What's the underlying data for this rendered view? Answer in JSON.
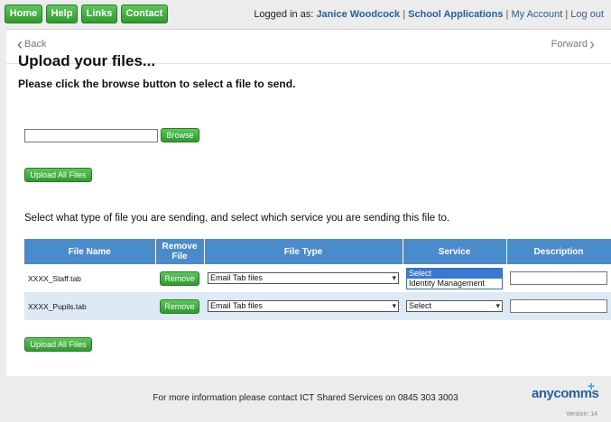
{
  "nav": {
    "home": "Home",
    "help": "Help",
    "links": "Links",
    "contact": "Contact"
  },
  "login": {
    "prefix": "Logged in as:",
    "user": "Janice Woodcock",
    "separator": "|",
    "school_apps": "School Applications",
    "my_account": "My Account",
    "logout": "Log out"
  },
  "pager": {
    "back": "Back",
    "forward": "Forward"
  },
  "upload": {
    "title": "Upload your files...",
    "subtitle": "Please click the browse button to select a file to send.",
    "file_input_value": "",
    "browse": "Browse",
    "upload_all": "Upload All Files",
    "instructions": "Select what type of file you are sending, and select which service you are sending this file to."
  },
  "table": {
    "headers": {
      "file_name": "File Name",
      "remove_file": "Remove File",
      "file_type": "File Type",
      "service": "Service",
      "description": "Description"
    },
    "rows": [
      {
        "file_name": "XXXX_Staff.tab",
        "remove": "Remove",
        "file_type": "Email Tab files",
        "service": "Select",
        "description": ""
      },
      {
        "file_name": "XXXX_Pupils.tab",
        "remove": "Remove",
        "file_type": "Email Tab files",
        "service": "Select",
        "description": ""
      }
    ],
    "service_dropdown_options": [
      "Select",
      "Identity Management"
    ]
  },
  "footer": {
    "info": "For more information please contact ICT Shared Services on 0845 303 3003",
    "logo_text": "anycomms",
    "logo_plus": "+",
    "version": "Version: 14"
  },
  "colors": {
    "accent_green": "#3aaa38",
    "header_blue": "#4a8bcc",
    "link_blue": "#2a5f9e"
  }
}
